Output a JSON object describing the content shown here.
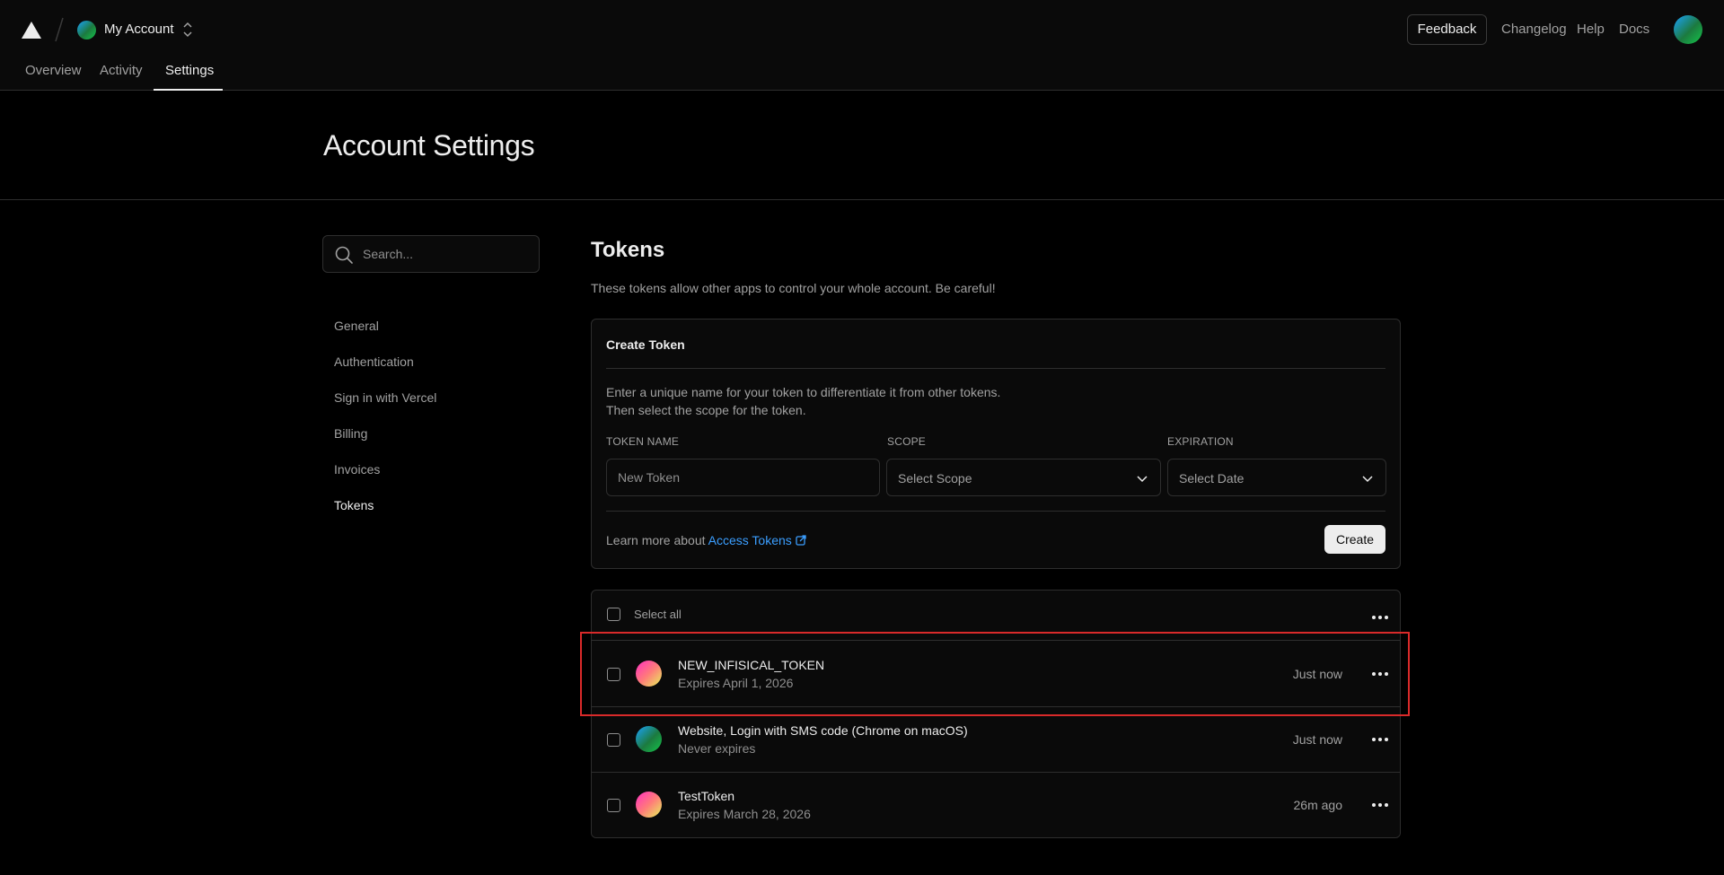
{
  "header": {
    "account_name": "My Account",
    "feedback_label": "Feedback",
    "links": [
      "Changelog",
      "Help",
      "Docs"
    ]
  },
  "nav": {
    "tabs": [
      "Overview",
      "Activity",
      "Settings"
    ],
    "active_tab": "Settings"
  },
  "page": {
    "title": "Account Settings"
  },
  "sidebar": {
    "search_placeholder": "Search...",
    "items": [
      "General",
      "Authentication",
      "Sign in with Vercel",
      "Billing",
      "Invoices",
      "Tokens"
    ],
    "active_item": "Tokens"
  },
  "tokens": {
    "title": "Tokens",
    "description": "These tokens allow other apps to control your whole account. Be careful!",
    "create": {
      "title": "Create Token",
      "help_line1": "Enter a unique name for your token to differentiate it from other tokens.",
      "help_line2": "Then select the scope for the token.",
      "name_label": "TOKEN NAME",
      "name_placeholder": "New Token",
      "scope_label": "SCOPE",
      "scope_value": "Select Scope",
      "expiration_label": "EXPIRATION",
      "expiration_value": "Select Date",
      "learn_prefix": "Learn more about",
      "learn_link": "Access Tokens",
      "create_label": "Create"
    },
    "list": {
      "select_all_label": "Select all",
      "rows": [
        {
          "name": "NEW_INFISICAL_TOKEN",
          "sub": "Expires April 1, 2026",
          "time": "Just now",
          "avatar": "pink"
        },
        {
          "name": "Website, Login with SMS code (Chrome on macOS)",
          "sub": "Never expires",
          "time": "Just now",
          "avatar": "green"
        },
        {
          "name": "TestToken",
          "sub": "Expires March 28, 2026",
          "time": "26m ago",
          "avatar": "pink"
        }
      ]
    }
  },
  "colors": {
    "background": "#000000",
    "surface": "#0a0a0a",
    "border": "#2e2e2e",
    "text_primary": "#ededed",
    "text_secondary": "#a1a1a1",
    "link": "#3b9eff",
    "highlight": "#d92a2a"
  },
  "icons": {
    "logo": "triangle-logo-icon",
    "switcher": "chevron-up-down-icon",
    "search": "search-icon",
    "select": "chevron-down-icon",
    "external": "external-link-icon",
    "more": "more-horizontal-icon"
  }
}
